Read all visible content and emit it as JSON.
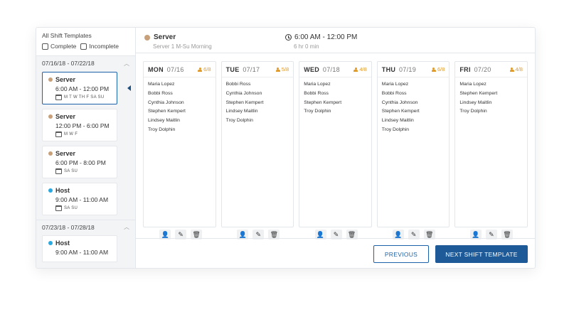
{
  "colors": {
    "server": "#c8a07a",
    "host": "#2aa8e0",
    "accent": "#1d5a97",
    "count": "#e09a2a"
  },
  "sidebar": {
    "title": "All Shift Templates",
    "filter_complete": "Complete",
    "filter_incomplete": "Incomplete",
    "groups": [
      {
        "range": "07/16/18 - 07/22/18",
        "cards": [
          {
            "role": "Server",
            "time": "6:00 AM - 12:00 PM",
            "days": "M T W TH F SA SU"
          },
          {
            "role": "Server",
            "time": "12:00 PM - 6:00 PM",
            "days": "M W F"
          },
          {
            "role": "Server",
            "time": "6:00 PM - 8:00 PM",
            "days": "SA SU"
          },
          {
            "role": "Host",
            "time": "9:00 AM - 11:00 AM",
            "days": "SA SU"
          }
        ]
      },
      {
        "range": "07/23/18 - 07/28/18",
        "cards": [
          {
            "role": "Host",
            "time": "9:00 AM - 11:00 AM"
          }
        ]
      }
    ]
  },
  "header": {
    "role": "Server",
    "subtitle": "Server 1 M-Su Morning",
    "time": "6:00 AM - 12:00 PM",
    "duration": "6 hr 0 min"
  },
  "days": [
    {
      "name": "MON",
      "date": "07/16",
      "count": "6/8",
      "people": [
        "Maria Lopez",
        "Bobbi Ross",
        "Cynthia Johnson",
        "Stephen Kempert",
        "Lindsey Maitlin",
        "Troy Dolphin"
      ]
    },
    {
      "name": "TUE",
      "date": "07/17",
      "count": "5/8",
      "people": [
        "Bobbi Ross",
        "Cynthia Johnson",
        "Stephen Kempert",
        "Lindsey Maitlin",
        "Troy Dolphin"
      ]
    },
    {
      "name": "WED",
      "date": "07/18",
      "count": "4/8",
      "people": [
        "Maria Lopez",
        "Bobbi Ross",
        "Stephen Kempert",
        "Troy Dolphin"
      ]
    },
    {
      "name": "THU",
      "date": "07/19",
      "count": "6/8",
      "people": [
        "Maria Lopez",
        "Bobbi Ross",
        "Cynthia Johnson",
        "Stephen Kempert",
        "Lindsey Maitlin",
        "Troy Dolphin"
      ]
    },
    {
      "name": "FRI",
      "date": "07/20",
      "count": "4/8",
      "people": [
        "Maria Lopez",
        "Stephen Kempert",
        "Lindsey Maitlin",
        "Troy Dolphin"
      ]
    }
  ],
  "footer": {
    "previous_label": "PREVIOUS",
    "next_label": "NEXT SHIFT TEMPLATE"
  }
}
